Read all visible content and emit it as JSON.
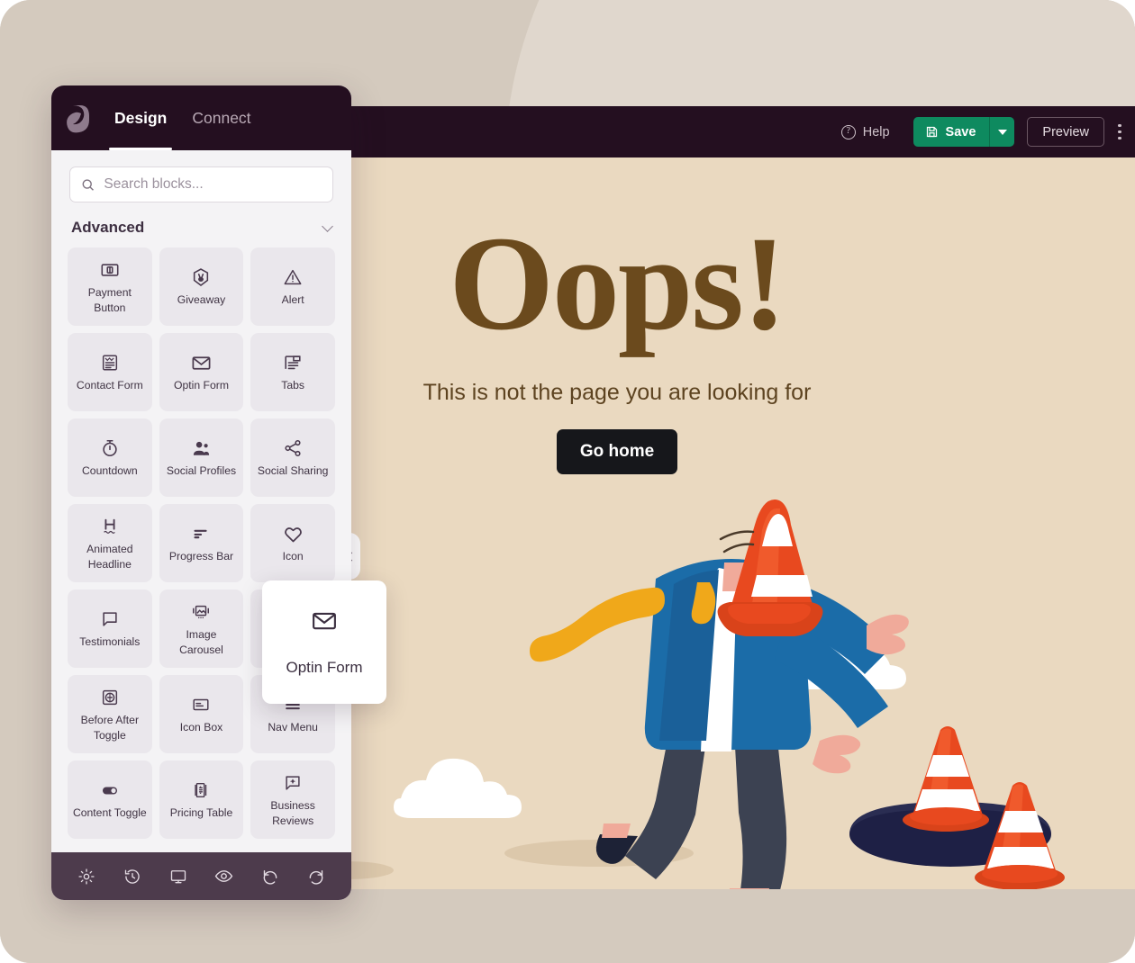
{
  "topbar": {
    "help_label": "Help",
    "help_icon": "question-circle-icon",
    "save_label": "Save",
    "save_icon": "floppy-disk-icon",
    "save_caret_icon": "caret-down-icon",
    "preview_label": "Preview",
    "menu_icon": "kebab-menu-icon",
    "accent_green": "#0e8a5f",
    "bar_color": "#240f20"
  },
  "panel": {
    "logo_icon": "leaf-logo-icon",
    "tabs": [
      {
        "label": "Design",
        "active": true
      },
      {
        "label": "Connect",
        "active": false
      }
    ],
    "search": {
      "placeholder": "Search blocks...",
      "value": "",
      "icon": "search-icon"
    },
    "section": {
      "title": "Advanced",
      "chevron_icon": "chevron-down-icon",
      "expanded": true
    },
    "blocks": [
      {
        "label": "Payment Button",
        "icon": "payment-button-icon"
      },
      {
        "label": "Giveaway",
        "icon": "giveaway-icon"
      },
      {
        "label": "Alert",
        "icon": "alert-triangle-icon"
      },
      {
        "label": "Contact Form",
        "icon": "contact-form-icon"
      },
      {
        "label": "Optin Form",
        "icon": "envelope-icon"
      },
      {
        "label": "Tabs",
        "icon": "tabs-icon"
      },
      {
        "label": "Countdown",
        "icon": "stopwatch-icon"
      },
      {
        "label": "Social Profiles",
        "icon": "users-icon"
      },
      {
        "label": "Social Sharing",
        "icon": "share-icon"
      },
      {
        "label": "Animated Headline",
        "icon": "animated-headline-icon"
      },
      {
        "label": "Progress Bar",
        "icon": "progress-bar-icon"
      },
      {
        "label": "Icon",
        "icon": "heart-icon"
      },
      {
        "label": "Testimonials",
        "icon": "speech-bubble-icon"
      },
      {
        "label": "Image Carousel",
        "icon": "image-carousel-icon"
      },
      {
        "label": "Optin Form",
        "icon": "envelope-icon"
      },
      {
        "label": "Before After Toggle",
        "icon": "before-after-toggle-icon"
      },
      {
        "label": "Icon Box",
        "icon": "icon-box-icon"
      },
      {
        "label": "Nav Menu",
        "icon": "hamburger-menu-icon"
      },
      {
        "label": "Content Toggle",
        "icon": "toggle-switch-icon"
      },
      {
        "label": "Pricing Table",
        "icon": "pricing-table-icon"
      },
      {
        "label": "Business Reviews",
        "icon": "business-reviews-icon"
      }
    ],
    "footer_icons": [
      {
        "name": "settings-gear-icon"
      },
      {
        "name": "revision-history-icon"
      },
      {
        "name": "desktop-monitor-icon"
      },
      {
        "name": "preview-eye-icon"
      },
      {
        "name": "undo-icon"
      },
      {
        "name": "redo-icon"
      }
    ],
    "collapse_handle_icon": "chevron-left-icon"
  },
  "drag_card": {
    "label": "Optin Form",
    "icon": "envelope-icon"
  },
  "canvas": {
    "title": "Oops!",
    "subtitle": "This is not the page you are looking for",
    "button_label": "Go home",
    "background": "#ead9c0",
    "title_color": "#6b4a1d",
    "button_color": "#16171b",
    "illustration": {
      "name": "man-with-traffic-cone-on-head-near-hole",
      "cone_color": "#e8491f",
      "jacket_color": "#1b6ca8",
      "scarf_color": "#f0a81a",
      "trousers_color": "#3c4252",
      "hole_color": "#1e2045"
    }
  }
}
